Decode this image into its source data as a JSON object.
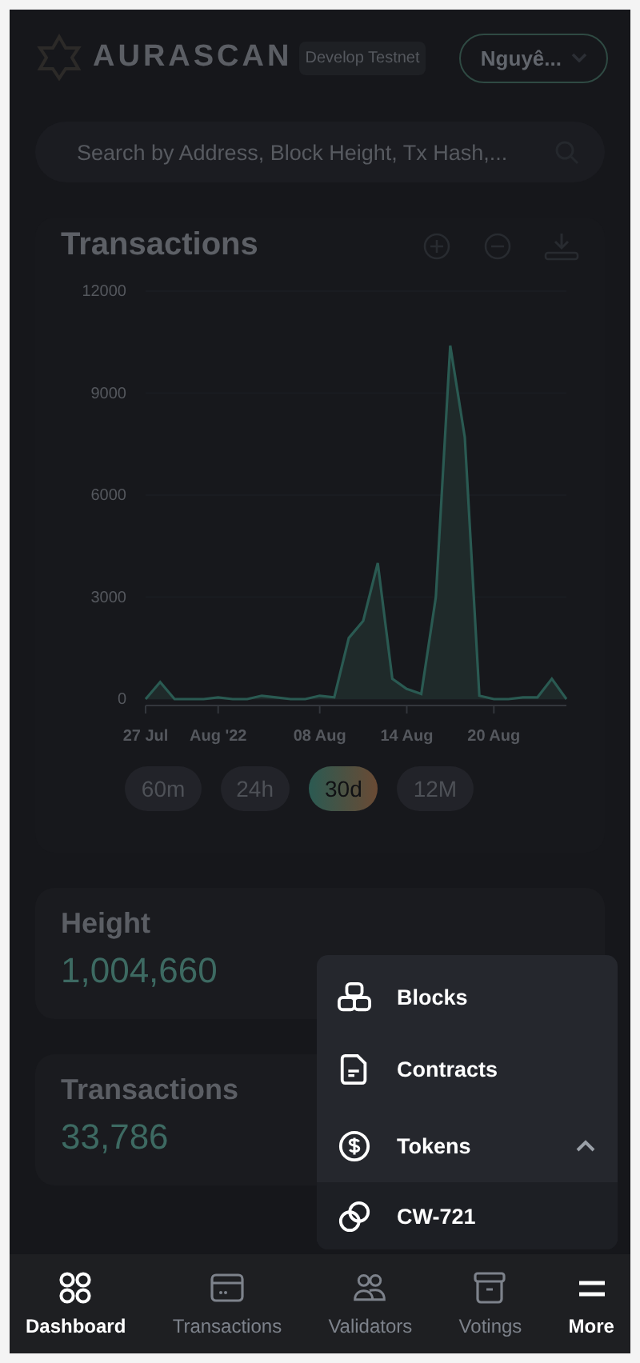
{
  "header": {
    "logo_text": "AURASCAN",
    "network_badge": "Develop Testnet",
    "account_button": "Nguyê..."
  },
  "search": {
    "placeholder": "Search by Address, Block Height, Tx Hash,..."
  },
  "transactions_card": {
    "title": "Transactions",
    "chart_data": {
      "type": "area",
      "categories": [
        "27 Jul",
        null,
        null,
        null,
        null,
        "Aug '22",
        null,
        null,
        null,
        null,
        null,
        null,
        "08 Aug",
        null,
        null,
        null,
        null,
        null,
        "14 Aug",
        null,
        null,
        null,
        null,
        null,
        "20 Aug",
        null,
        null,
        null,
        null,
        null
      ],
      "series": [
        {
          "color": "#2a5a52",
          "values": [
            0,
            500,
            0,
            0,
            0,
            50,
            0,
            0,
            100,
            50,
            0,
            0,
            100,
            50,
            1800,
            2300,
            4000,
            600,
            300,
            150,
            3000,
            10400,
            7700,
            100,
            0,
            0,
            50,
            50,
            600,
            0
          ]
        }
      ],
      "ylim": [
        0,
        12000
      ],
      "yticks": [
        0,
        3000,
        6000,
        9000,
        12000
      ]
    },
    "ranges": [
      {
        "label": "60m",
        "selected": false
      },
      {
        "label": "24h",
        "selected": false
      },
      {
        "label": "30d",
        "selected": true
      },
      {
        "label": "12M",
        "selected": false
      }
    ]
  },
  "stats": [
    {
      "label": "Height",
      "value": "1,004,660"
    },
    {
      "label": "Transactions",
      "value": "33,786"
    }
  ],
  "more_menu": {
    "items": [
      {
        "label": "Blocks"
      },
      {
        "label": "Contracts"
      },
      {
        "label": "Tokens",
        "expanded": true,
        "children": [
          {
            "label": "CW-721"
          }
        ]
      }
    ]
  },
  "bottom_nav": [
    {
      "label": "Dashboard",
      "selected": true
    },
    {
      "label": "Transactions",
      "selected": false
    },
    {
      "label": "Validators",
      "selected": false
    },
    {
      "label": "Votings",
      "selected": false
    },
    {
      "label": "More",
      "selected": true
    }
  ]
}
